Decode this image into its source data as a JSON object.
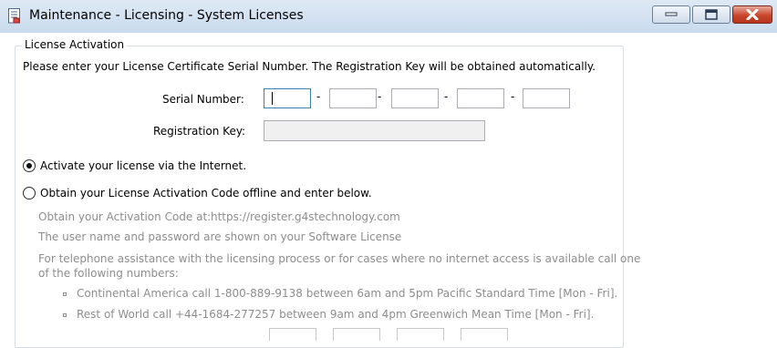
{
  "window": {
    "title": "Maintenance - Licensing - System Licenses"
  },
  "license_activation": {
    "group_title": "License Activation",
    "instructions": "Please enter your License Certificate Serial Number. The Registration Key will be obtained automatically.",
    "serial_label": "Serial Number:",
    "serial_fields": [
      "",
      "",
      "",
      "",
      ""
    ],
    "separator": "-",
    "registration_label": "Registration Key:",
    "registration_value": ""
  },
  "options": {
    "internet": {
      "label": "Activate your license via the Internet.",
      "selected": true
    },
    "offline": {
      "label": "Obtain your License Activation Code offline and enter below.",
      "selected": false
    }
  },
  "offline_info": {
    "activation_code_label": "Obtain your Activation Code at:",
    "activation_url": "https://register.g4stechnology.com",
    "credentials_note": "The user name and password are shown on your Software License",
    "telephone_note_line1": "For telephone assistance with the licensing process or for cases where no internet access is available call one",
    "telephone_note_line2": "of the following numbers:",
    "phone_items": [
      "Continental America call 1-800-889-9138 between 6am and 5pm Pacific Standard Time [Mon - Fri].",
      "Rest of World call +44-1684-277257 between 9am and 4pm Greenwich Mean Time [Mon - Fri]."
    ]
  },
  "icons": {
    "app": "document-icon",
    "minimize": "minimize-icon",
    "maximize": "maximize-icon",
    "close": "close-icon"
  }
}
